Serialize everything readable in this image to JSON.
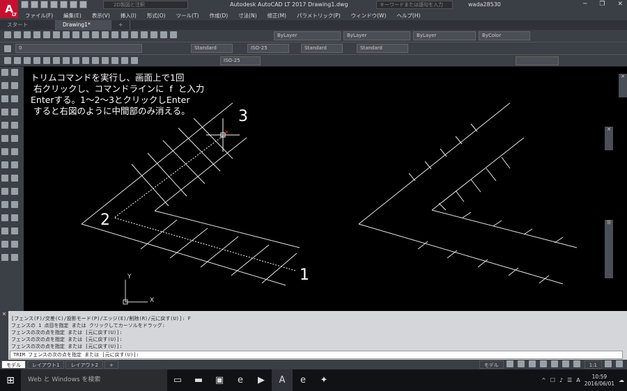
{
  "titlebar": {
    "logo": "A",
    "logo_sub": "LT",
    "workspace": "2D製図と注釈",
    "window_title": "Autodesk AutoCAD LT 2017   Drawing1.dwg",
    "search_placeholder": "キーワードまたは語句を入力",
    "user": "wada28530",
    "help": "?"
  },
  "menu": [
    "ファイル(F)",
    "編集(E)",
    "表示(V)",
    "挿入(I)",
    "形式(O)",
    "ツール(T)",
    "作成(D)",
    "寸法(N)",
    "修正(M)",
    "パラメトリック(P)",
    "ウィンドウ(W)",
    "ヘルプ(H)"
  ],
  "tabs": {
    "start": "スタート",
    "drawing": "Drawing1*",
    "new": "+"
  },
  "toolbar": {
    "layer_value": "0",
    "bylayer1": "ByLayer",
    "bylayer2": "ByLayer",
    "bylayer3": "ByLayer",
    "bycolor": "ByColor",
    "text_style": "Standard",
    "dim_style": "ISO-25",
    "table_style": "Standard",
    "mleader_style": "Standard",
    "dim_style2": "ISO-25"
  },
  "drawing": {
    "instruction": "トリムコマンドを実行し、画面上で1回\n 右クリックし、コマンドラインに  f  と入力\nEnterする。1～2～3とクリックしEnter\n すると右図のように中間部のみ消える。",
    "label1": "1",
    "label2": "2",
    "label3": "3",
    "ucs_x": "X",
    "ucs_y": "Y"
  },
  "command": {
    "history": [
      "[フェンス(F)/交差(C)/投影モード(P)/エッジ(E)/削除(R)/元に戻す(U)]: F",
      "フェンスの 1 点目を指定 または クリックしてカーソルをドラッグ:",
      "フェンスの次の点を指定 または [元に戻す(U)]:",
      "フェンスの次の点を指定 または [元に戻す(U)]:",
      "フェンスの次の点を指定 または [元に戻す(U)]:"
    ],
    "prompt": "TRIM フェンスの次の点を指定 または [元に戻す(U)]:"
  },
  "layout_tabs": [
    "モデル",
    "レイアウト1",
    "レイアウト2",
    "+"
  ],
  "status": {
    "model": "モデル",
    "scale": "1:1"
  },
  "taskbar": {
    "search_placeholder": "Web と Windows を検索",
    "time": "10:59",
    "date": "2016/06/01",
    "ime": "A"
  }
}
